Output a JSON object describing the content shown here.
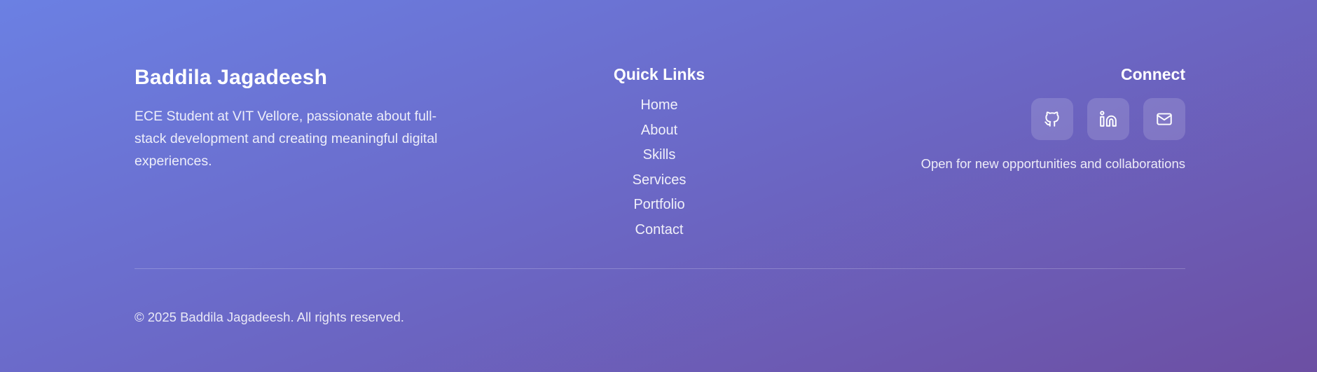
{
  "brand": {
    "name": "Baddila Jagadeesh",
    "description": "ECE Student at VIT Vellore, passionate about full-stack development and creating meaningful digital experiences."
  },
  "quick_links": {
    "title": "Quick Links",
    "items": [
      {
        "label": "Home"
      },
      {
        "label": "About"
      },
      {
        "label": "Skills"
      },
      {
        "label": "Services"
      },
      {
        "label": "Portfolio"
      },
      {
        "label": "Contact"
      }
    ]
  },
  "connect": {
    "title": "Connect",
    "socials": [
      {
        "icon": "github-icon"
      },
      {
        "icon": "linkedin-icon"
      },
      {
        "icon": "mail-icon"
      }
    ],
    "note": "Open for new opportunities and collaborations"
  },
  "footer": {
    "copyright": "© 2025 Baddila Jagadeesh. All rights reserved."
  },
  "colors": {
    "gradient_start": "#6b80e3",
    "gradient_end": "#6c4fa3",
    "text": "#ffffff"
  }
}
